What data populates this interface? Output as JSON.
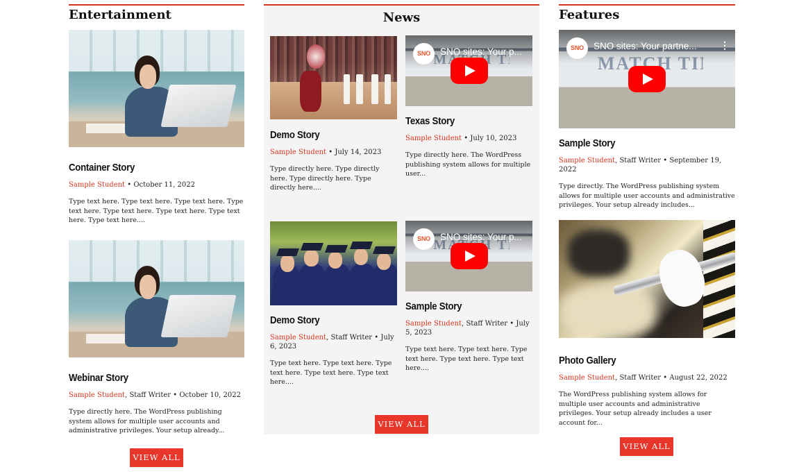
{
  "columns": {
    "entertainment": {
      "title": "Entertainment",
      "stories": [
        {
          "headline": "Container Story",
          "author": "Sample Student",
          "meta": " • October 11, 2022",
          "excerpt": "Type text here. Type text here. Type text here. Type text here. Type text here. Type text here. Type text here. Type text here...."
        },
        {
          "headline": "Webinar Story",
          "author": "Sample Student",
          "meta": ", Staff Writer • October 10, 2022",
          "excerpt": "Type directly here. The WordPress publishing system allows for multiple user accounts and administrative privileges. Your setup already..."
        }
      ],
      "view_all": "VIEW ALL"
    },
    "news": {
      "title": "News",
      "stories": [
        {
          "headline": "Demo Story",
          "author": "Sample Student",
          "meta": " • July 14, 2023",
          "excerpt": "Type directly here. Type directly here. Type directly here. Type directly here...."
        },
        {
          "headline": "Texas Story",
          "author": "Sample Student",
          "meta": " • July 10, 2023",
          "excerpt": "Type directly here. The WordPress publishing system allows for multiple user...",
          "video_title": "SNO sites: Your p..."
        },
        {
          "headline": "Demo Story",
          "author": "Sample Student",
          "meta": ", Staff Writer • July 6, 2023",
          "excerpt": "Type text here. Type text here. Type text here. Type text here. Type text here...."
        },
        {
          "headline": "Sample Story",
          "author": "Sample Student",
          "meta": ", Staff Writer • July 5, 2023",
          "excerpt": "Type text here. Type text here. Type text here. Type text here. Type text here....",
          "video_title": "SNO sites: Your p..."
        }
      ],
      "view_all": "VIEW ALL"
    },
    "features": {
      "title": "Features",
      "stories": [
        {
          "headline": "Sample Story",
          "author": "Sample Student",
          "meta": ", Staff Writer • September 19, 2022",
          "excerpt": "Type directly. The WordPress publishing system allows for multiple user accounts and administrative privileges. Your setup already includes...",
          "video_title": "SNO sites: Your partne..."
        },
        {
          "headline": "Photo Gallery",
          "author": "Sample Student",
          "meta": ", Staff Writer • August 22, 2022",
          "excerpt": "The WordPress publishing system allows for multiple user accounts and administrative privileges. Your setup already includes a user account for..."
        }
      ],
      "view_all": "VIEW ALL"
    }
  },
  "video": {
    "logo_text": "SNO",
    "menu_glyph": "⋮"
  },
  "colors": {
    "accent": "#e8362a",
    "author": "#d9351e",
    "news_bg": "#f4f4f4",
    "youtube_red": "#ff0000"
  }
}
